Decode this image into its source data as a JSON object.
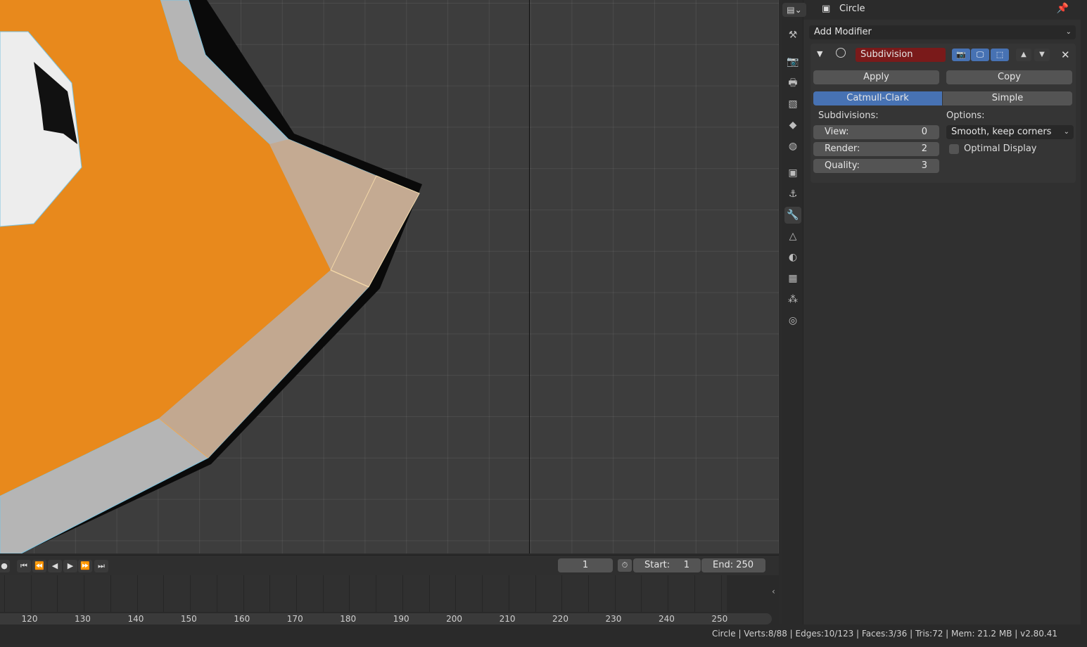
{
  "colors": {
    "object_orange": "#e8891c",
    "selected_face": "#c4aa92",
    "edge_blue": "#7cc4e0",
    "active_tab_blue": "#4772b3",
    "modifier_name_red": "#7a1a1a"
  },
  "properties": {
    "editor_icon": "properties-editor-icon",
    "object_name": "Circle",
    "add_modifier": "Add Modifier",
    "tabs": [
      "tool-icon",
      "render-icon",
      "output-icon",
      "view-layer-icon",
      "scene-icon",
      "world-icon",
      "object-icon",
      "constraints-icon",
      "modifier-wrench-icon",
      "mesh-data-icon",
      "material-icon",
      "texture-icon",
      "particles-icon",
      "physics-icon"
    ],
    "modifier": {
      "name": "Subdivision",
      "apply": "Apply",
      "copy": "Copy",
      "type_options": [
        "Catmull-Clark",
        "Simple"
      ],
      "type_selected": "Catmull-Clark",
      "subdivisions_label": "Subdivisions:",
      "view_label": "View:",
      "view_value": "0",
      "render_label": "Render:",
      "render_value": "2",
      "quality_label": "Quality:",
      "quality_value": "3",
      "options_label": "Options:",
      "uv_smooth": "Smooth, keep corners",
      "optimal_display_label": "Optimal Display",
      "optimal_display": false
    }
  },
  "timeline": {
    "current_frame": "1",
    "start_label": "Start:",
    "start_value": "1",
    "end_label": "End:",
    "end_value": "250",
    "ticks": [
      "120",
      "130",
      "140",
      "150",
      "160",
      "170",
      "180",
      "190",
      "200",
      "210",
      "220",
      "230",
      "240",
      "250"
    ]
  },
  "status": {
    "text": "Circle | Verts:8/88 | Edges:10/123 | Faces:3/36 | Tris:72 | Mem: 21.2 MB | v2.80.41"
  }
}
